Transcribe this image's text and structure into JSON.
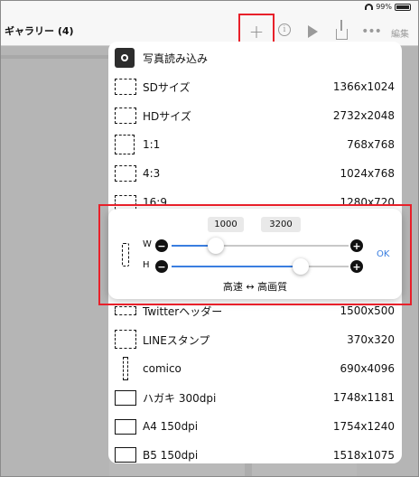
{
  "status": {
    "battery": "99%"
  },
  "navbar": {
    "title": "ギャラリー (4)",
    "plus": "+",
    "info": "i",
    "more": "•••",
    "edit": "編集"
  },
  "menu": {
    "import_label": "写真読み込み",
    "items": [
      {
        "label": "SDサイズ",
        "size": "1366x1024"
      },
      {
        "label": "HDサイズ",
        "size": "2732x2048"
      },
      {
        "label": "1:1",
        "size": "768x768"
      },
      {
        "label": "4:3",
        "size": "1024x768"
      },
      {
        "label": "16:9",
        "size": "1280x720"
      },
      {
        "label": "Twitterヘッダー",
        "size": "1500x500"
      },
      {
        "label": "LINEスタンプ",
        "size": "370x320"
      },
      {
        "label": "comico",
        "size": "690x4096"
      },
      {
        "label": "ハガキ 300dpi",
        "size": "1748x1181"
      },
      {
        "label": "A4 150dpi",
        "size": "1754x1240"
      },
      {
        "label": "B5 150dpi",
        "size": "1518x1075"
      }
    ]
  },
  "custom_size": {
    "width_value": "1000",
    "separator": "x",
    "height_value": "3200",
    "w_label": "W",
    "h_label": "H",
    "minus": "−",
    "plus": "+",
    "ok": "OK",
    "quality_label": "高速 ↔ 高画質",
    "w_level": 0.25,
    "h_level": 0.73
  },
  "colors": {
    "accent": "#3a7ee0",
    "highlight": "#e8202a"
  },
  "icons": [
    "camera-icon",
    "wifi-icon",
    "battery-icon",
    "info-icon",
    "play-icon",
    "share-icon",
    "more-icon"
  ]
}
